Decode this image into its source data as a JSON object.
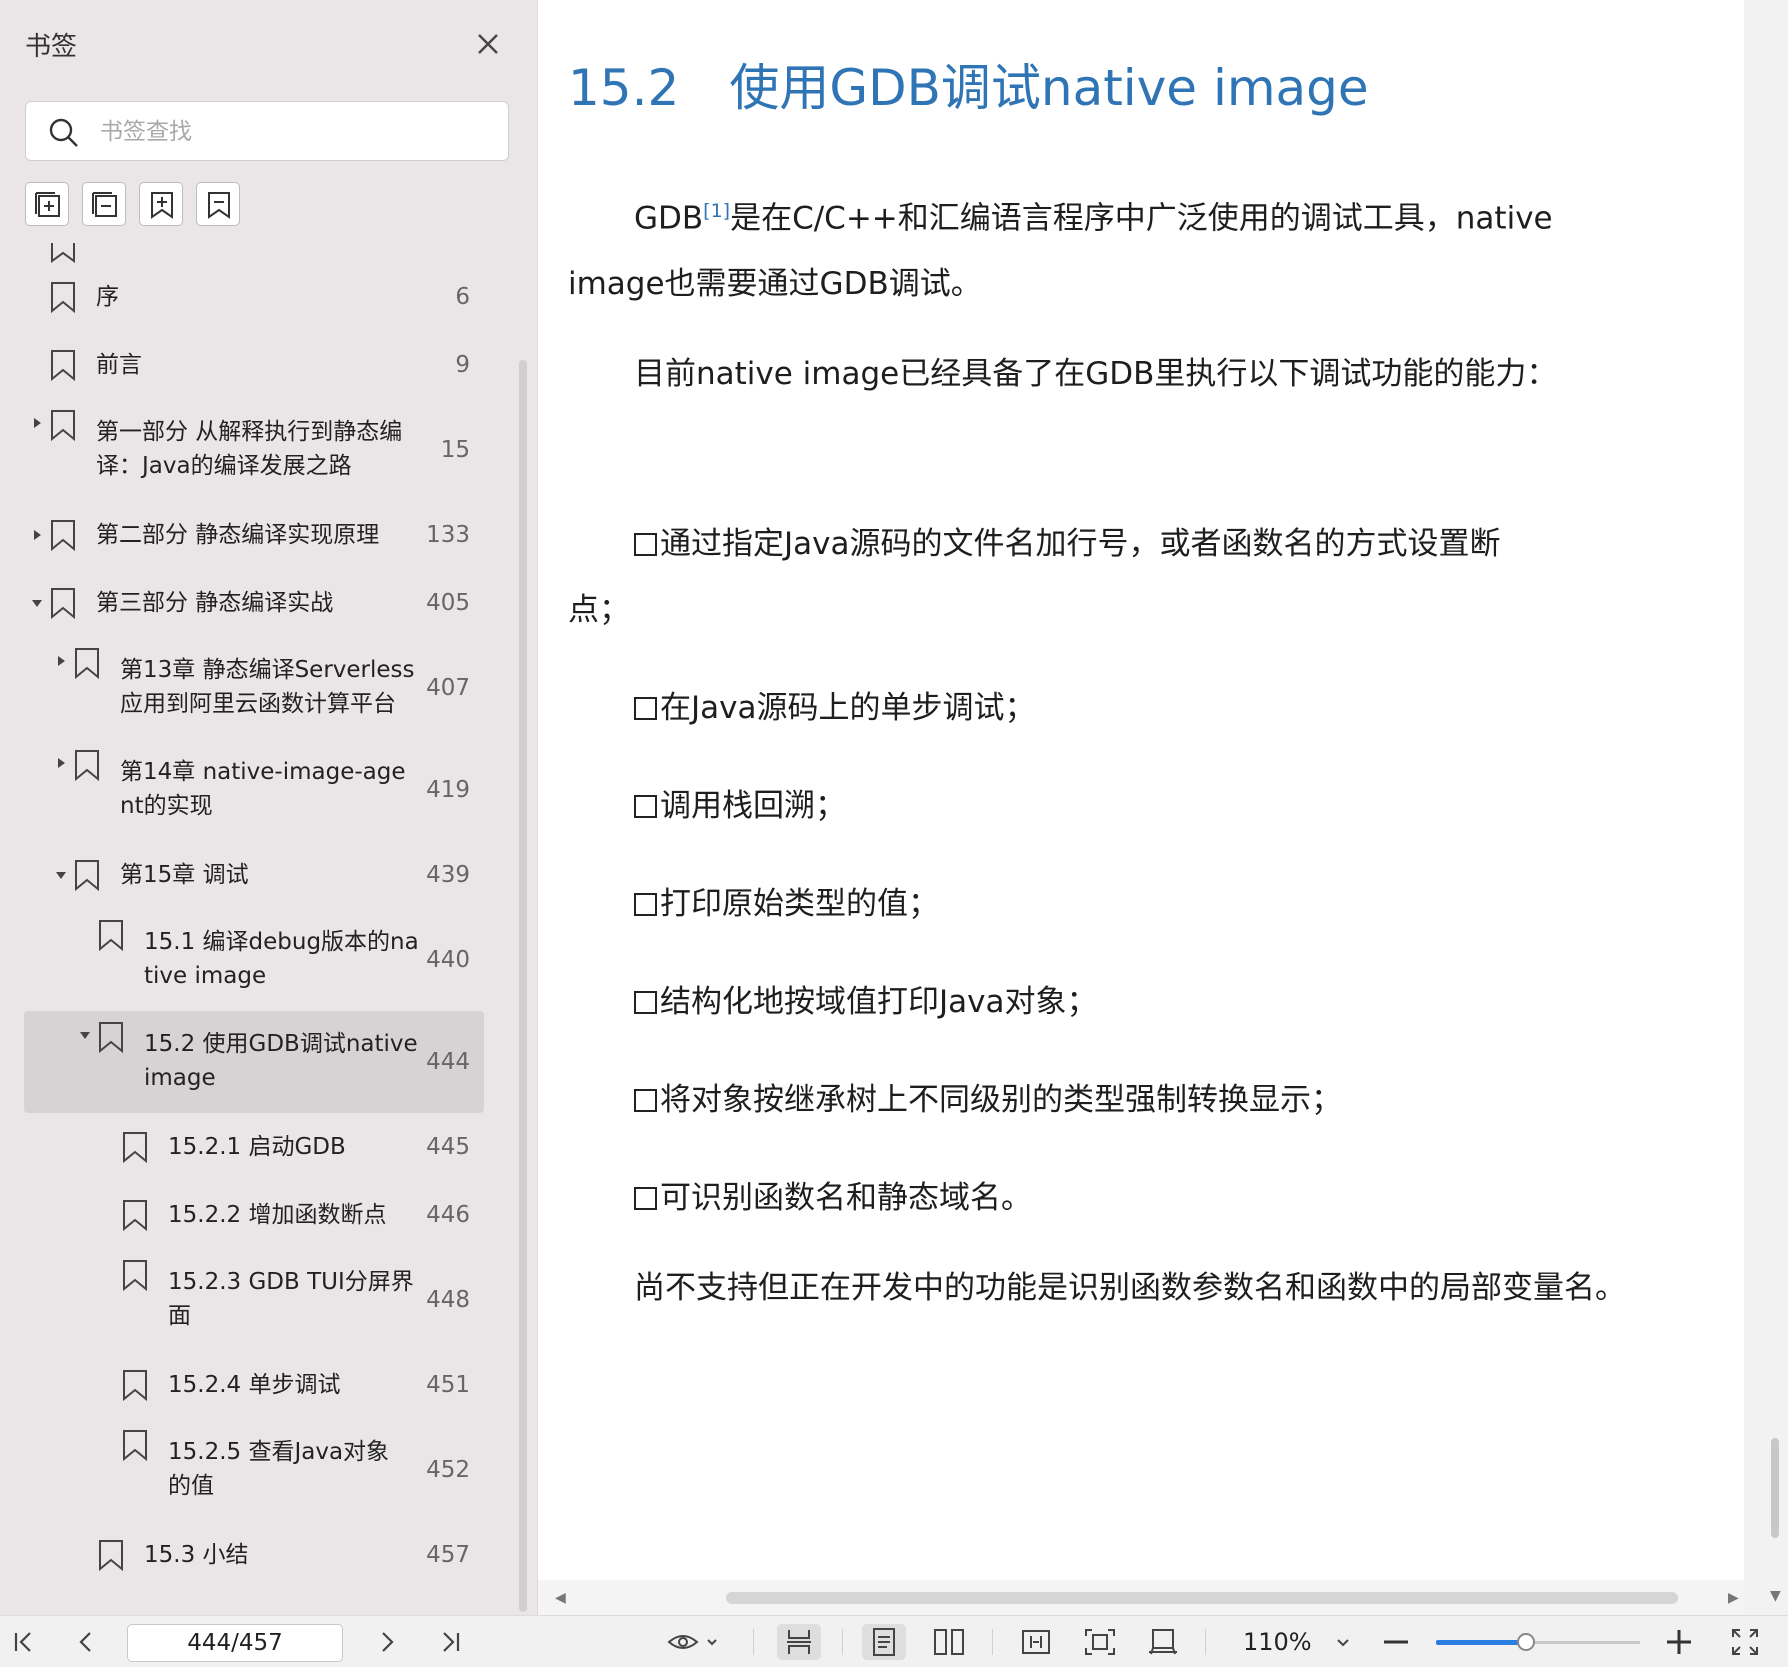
{
  "sidebar": {
    "title": "书签",
    "search_placeholder": "书签查找",
    "items": [
      {
        "label": "序",
        "page": "6",
        "level": 0,
        "arrow": "none"
      },
      {
        "label": "前言",
        "page": "9",
        "level": 0,
        "arrow": "none"
      },
      {
        "label": "第一部分 从解释执行到静态编\n译：Java的编译发展之路",
        "page": "15",
        "level": 0,
        "arrow": "collapsed"
      },
      {
        "label": "第二部分 静态编译实现原理",
        "page": "133",
        "level": 0,
        "arrow": "collapsed"
      },
      {
        "label": "第三部分 静态编译实战",
        "page": "405",
        "level": 0,
        "arrow": "expanded"
      },
      {
        "label": "第13章 静态编译Serverless\n应用到阿里云函数计算平台",
        "page": "407",
        "level": 1,
        "arrow": "collapsed"
      },
      {
        "label": "第14章 native-image-age\nnt的实现",
        "page": "419",
        "level": 1,
        "arrow": "collapsed"
      },
      {
        "label": "第15章 调试",
        "page": "439",
        "level": 1,
        "arrow": "expanded"
      },
      {
        "label": "15.1 编译debug版本的na\ntive image",
        "page": "440",
        "level": 2,
        "arrow": "none"
      },
      {
        "label": "15.2 使用GDB调试native\nimage",
        "page": "444",
        "level": 2,
        "arrow": "expanded",
        "selected": true
      },
      {
        "label": "15.2.1 启动GDB",
        "page": "445",
        "level": 3,
        "arrow": "none"
      },
      {
        "label": "15.2.2 增加函数断点",
        "page": "446",
        "level": 3,
        "arrow": "none"
      },
      {
        "label": "15.2.3 GDB TUI分屏界\n面",
        "page": "448",
        "level": 3,
        "arrow": "none"
      },
      {
        "label": "15.2.4 单步调试",
        "page": "451",
        "level": 3,
        "arrow": "none"
      },
      {
        "label": "15.2.5 查看Java对象\n的值",
        "page": "452",
        "level": 3,
        "arrow": "none"
      },
      {
        "label": "15.3 小结",
        "page": "457",
        "level": 2,
        "arrow": "none"
      }
    ]
  },
  "document": {
    "heading": "15.2　使用GDB调试native image",
    "p1_before": "GDB",
    "p1_sup": "[1]",
    "p1_after": "是在C/C++和汇编语言程序中广泛使用的调试工具，native image也需要通过GDB调试。",
    "p2": "目前native image已经具备了在GDB里执行以下调试功能的能力：",
    "b1_line1": "通过指定Java源码的文件名加行号，或者函数名的方式设置断",
    "b1_line2": "点；",
    "b2": "在Java源码上的单步调试；",
    "b3": "调用栈回溯；",
    "b4": "打印原始类型的值；",
    "b5": "结构化地按域值打印Java对象；",
    "b6": "将对象按继承树上不同级别的类型强制转换显示；",
    "b7": "可识别函数名和静态域名。",
    "p3": "尚不支持但正在开发中的功能是识别函数参数名和函数中的局部变量名。"
  },
  "toolbar": {
    "page_indicator": "444/457",
    "zoom": "110%",
    "zoom_slider_fraction": 0.44
  },
  "colors": {
    "heading": "#2f74b5",
    "sidebar_bg": "#eae6e8",
    "slider_fill": "#2a7de1"
  }
}
